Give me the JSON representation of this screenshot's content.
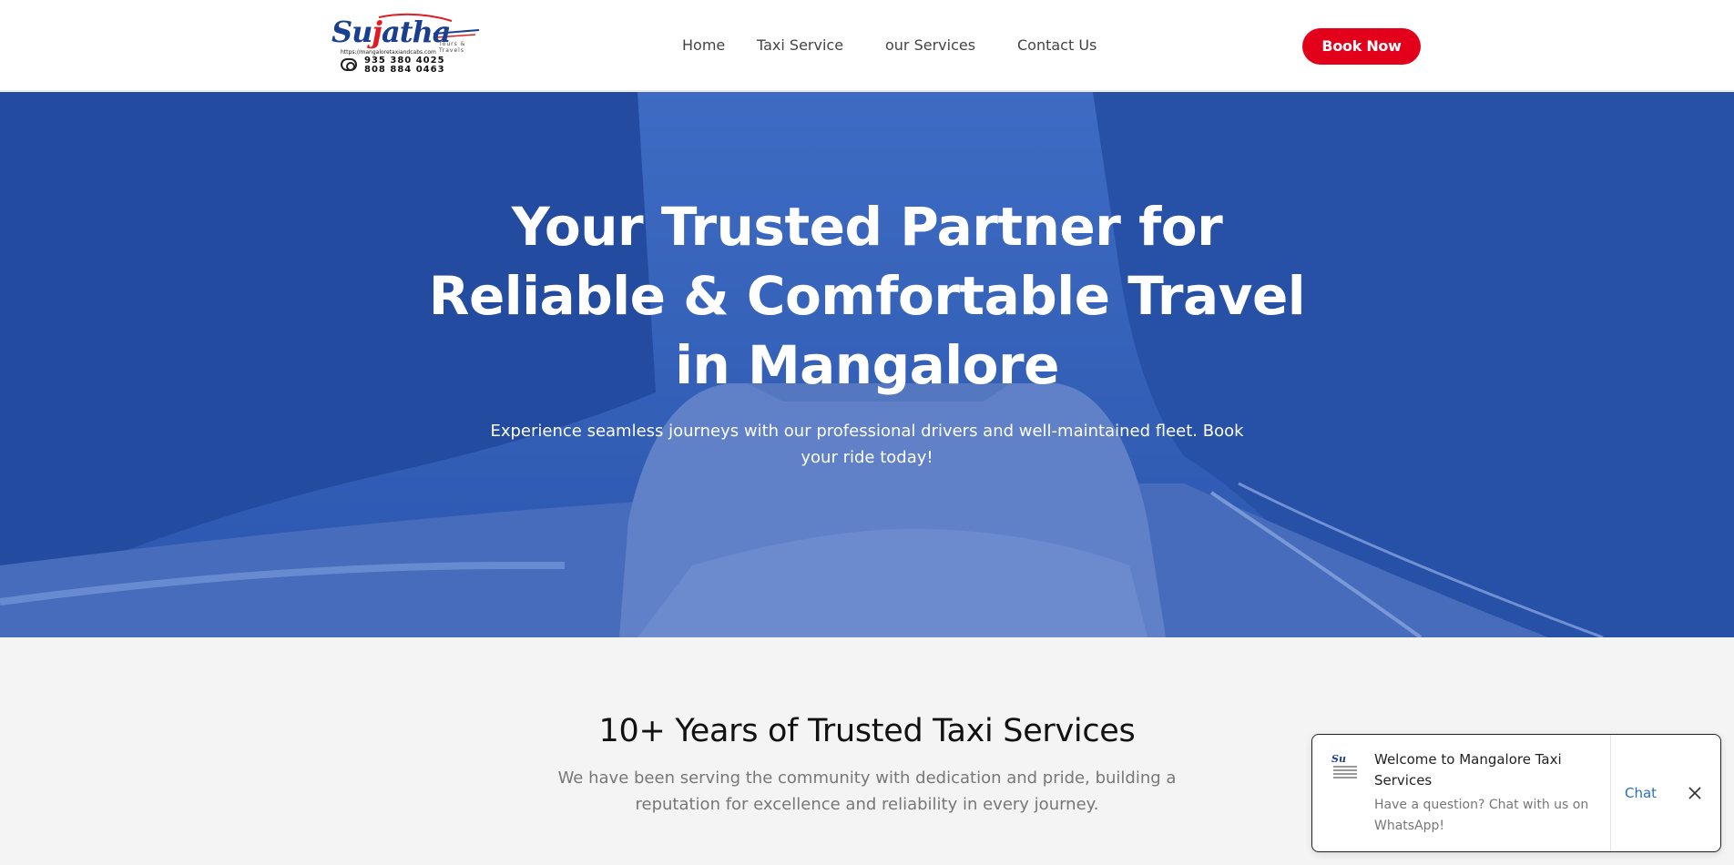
{
  "header": {
    "logo": {
      "script_pre": "Su",
      "script_hl": "j",
      "script_post": "atha",
      "tagline": "Tours & Travels",
      "url": "https://mangaloretaxiandcabs.com",
      "phone_1": "935 380 4025",
      "phone_2": "808 884 0463"
    },
    "nav": [
      {
        "label": "Home"
      },
      {
        "label": "Taxi Service"
      },
      {
        "label": "our Services"
      },
      {
        "label": "Contact Us"
      }
    ],
    "book_now_label": "Book Now",
    "book_now_color": "#e3001b"
  },
  "hero": {
    "title": "Your Trusted Partner for Reliable & Comfortable Travel in Mangalore",
    "subtitle": "Experience seamless journeys with our professional drivers and well-maintained fleet. Book your ride today!",
    "overlay_color": "#2456be"
  },
  "stats": {
    "title": "10+ Years of Trusted Taxi Services",
    "description": "We have been serving the community with dedication and pride, building a reputation for excellence and reliability in every journey."
  },
  "chat_widget": {
    "title": "Welcome to Mangalore Taxi Services",
    "message": "Have a question? Chat with us on WhatsApp!",
    "chat_label": "Chat",
    "close_icon": "close-icon"
  }
}
